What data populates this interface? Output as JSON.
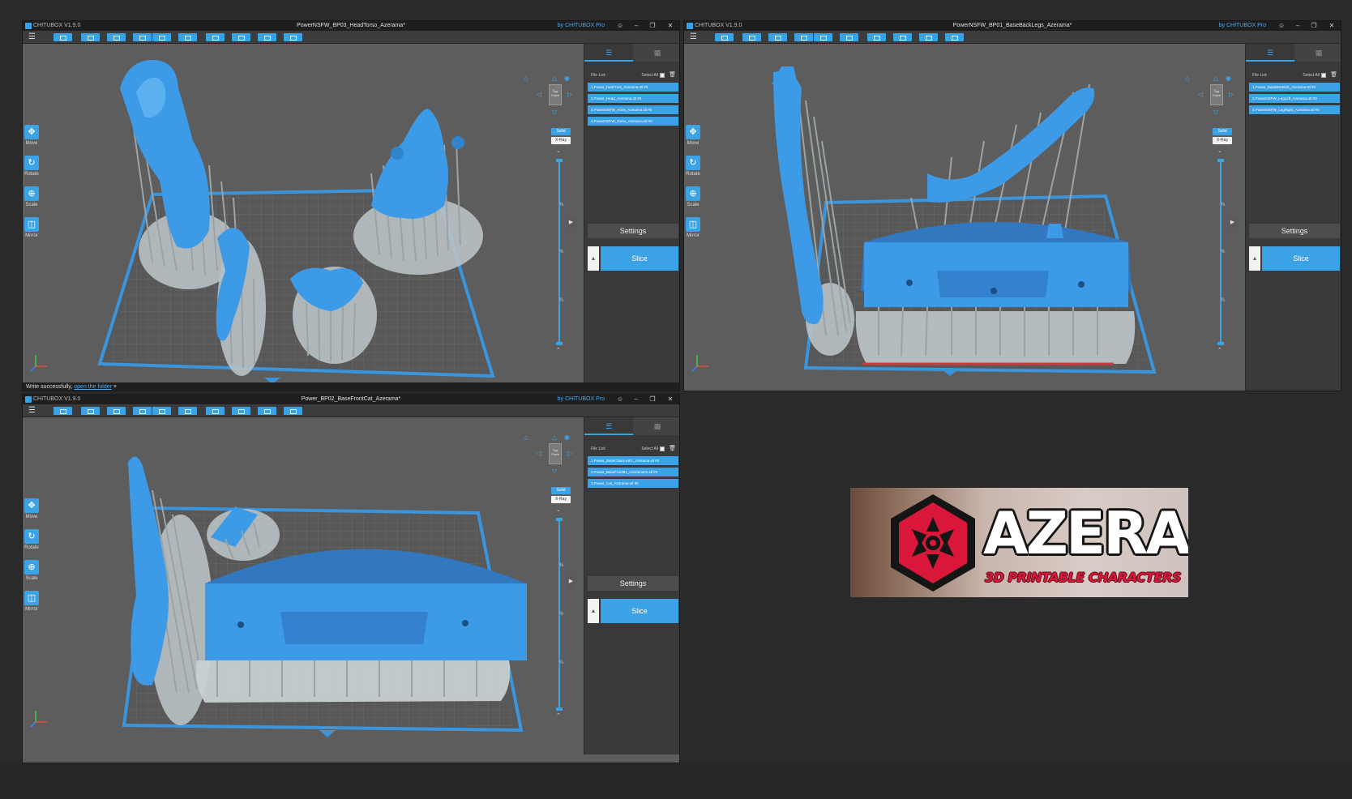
{
  "app": {
    "name": "CHITUBOX V1.9.0",
    "by_label": "by CHITUBOX Pro",
    "menu_icon": "hamburger-icon",
    "window_controls": [
      "person-icon",
      "minimize-icon",
      "restore-icon",
      "close-icon"
    ]
  },
  "tools": [
    {
      "label": "Move",
      "icon": "move-icon"
    },
    {
      "label": "Rotate",
      "icon": "rotate-icon"
    },
    {
      "label": "Scale",
      "icon": "scale-icon"
    },
    {
      "label": "Mirror",
      "icon": "mirror-icon"
    }
  ],
  "render_modes": {
    "solid": "Solid",
    "xray": "X-Ray"
  },
  "layer_fractions": [
    "¾",
    "½",
    "¼"
  ],
  "file_list_title": "File List:",
  "select_all": "Select All",
  "settings_label": "Settings",
  "slice_label": "Slice",
  "windows": [
    {
      "title": "PowerNSFW_BP03_HeadTorso_Azerama*",
      "files": [
        "1.Power_HairFront_Azerama.stl #0",
        "2.Power_Head_Azerama.stl #0",
        "3.PowerNSFW_Arms_Azerama.stl #0",
        "4.PowerNSFW_Torso_Azerama.stl #0"
      ],
      "status_text": "Write successfully,",
      "status_link": "open the folder"
    },
    {
      "title": "PowerNSFW_BP01_BaseBackLegs_Azerama*",
      "files": [
        "1.Power_BaseBackNS_Azerama.stl #0",
        "2.PowerNSFW_LegLeft_Azerama.stl #0",
        "3.PowerNSFW_LegRight_Azerama.stl #0"
      ]
    },
    {
      "title": "Power_BP02_BaseFrontCat_Azerama*",
      "files": [
        "1.Power_BaseChain.xml1_Azerama.stl #0",
        "2.Power_BaseFront01_Azerama01.stl #0",
        "3.Power_Cat_Azerama.stl #0"
      ]
    }
  ],
  "logo": {
    "name": "AZERAMA",
    "tagline": "3D PRINTABLE CHARACTERS",
    "colors": {
      "red": "#d8173a",
      "black": "#151515",
      "white": "#ffffff"
    }
  },
  "colors": {
    "accent": "#3ba2e5",
    "model": "#3d9ae6",
    "support": "#b9c2c5",
    "viewport": "#5d5d5d",
    "panel": "#393939",
    "titlebar": "#1e1e1e"
  }
}
